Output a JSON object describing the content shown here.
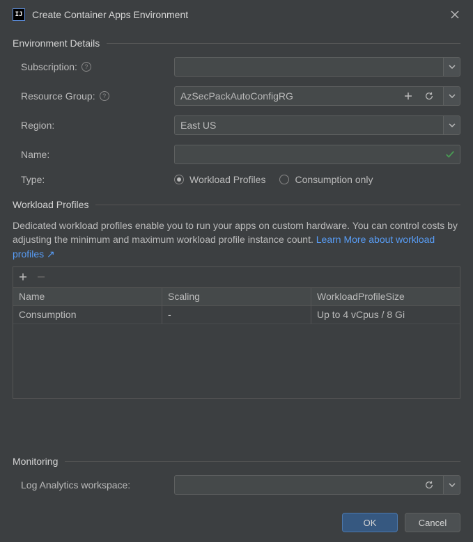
{
  "title": "Create Container Apps Environment",
  "sections": {
    "env": "Environment Details",
    "wp": "Workload Profiles",
    "mon": "Monitoring"
  },
  "env": {
    "subscription_label": "Subscription:",
    "subscription_value": "",
    "rg_label": "Resource Group:",
    "rg_value": "AzSecPackAutoConfigRG",
    "region_label": "Region:",
    "region_value": "East US",
    "name_label": "Name:",
    "name_value": "",
    "type_label": "Type:",
    "type_opt1": "Workload Profiles",
    "type_opt2": "Consumption only"
  },
  "wp": {
    "desc": "Dedicated workload profiles enable you to run your apps on custom hardware. You can control costs by adjusting the minimum and maximum workload profile instance count. ",
    "link": "Learn More about workload profiles ↗",
    "cols": {
      "name": "Name",
      "scaling": "Scaling",
      "size": "WorkloadProfileSize"
    },
    "rows": [
      {
        "name": "Consumption",
        "scaling": "-",
        "size": "Up to 4 vCpus / 8 Gi"
      }
    ]
  },
  "mon": {
    "law_label": "Log Analytics workspace:",
    "law_value": ""
  },
  "buttons": {
    "ok": "OK",
    "cancel": "Cancel"
  }
}
